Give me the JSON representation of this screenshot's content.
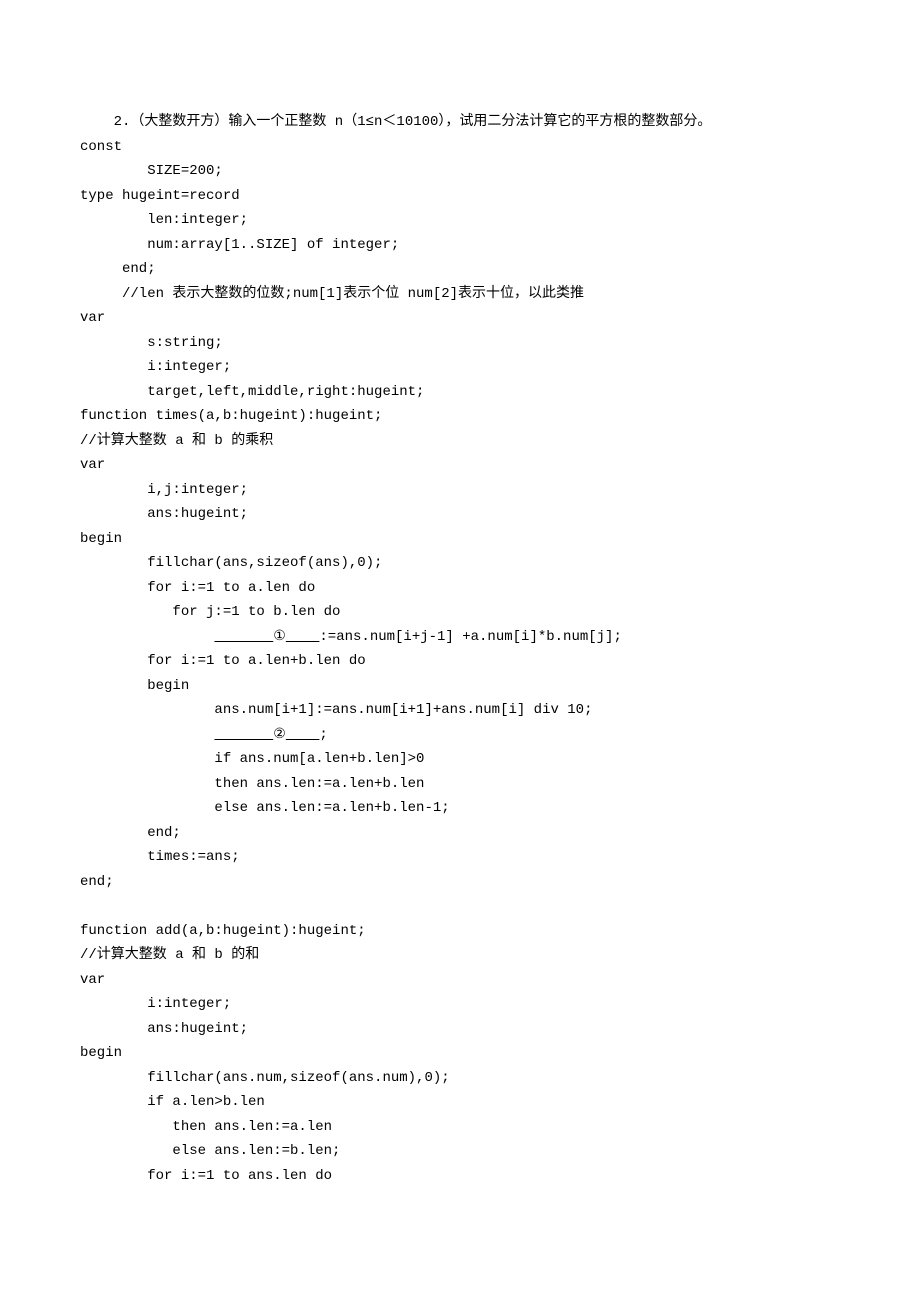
{
  "lines": [
    "    2.（大整数开方）输入一个正整数 n（1≤n＜10100），试用二分法计算它的平方根的整数部分。",
    "const",
    "        SIZE=200;",
    "type hugeint=record",
    "        len:integer;",
    "        num:array[1..SIZE] of integer;",
    "     end;",
    "     //len 表示大整数的位数;num[1]表示个位 num[2]表示十位，以此类推",
    "var",
    "        s:string;",
    "        i:integer;",
    "        target,left,middle,right:hugeint;",
    "function times(a,b:hugeint):hugeint;",
    "//计算大整数 a 和 b 的乘积",
    "var",
    "        i,j:integer;",
    "        ans:hugeint;",
    "begin",
    "        fillchar(ans,sizeof(ans),0);",
    "        for i:=1 to a.len do",
    "           for j:=1 to b.len do",
    "                       ①    :=ans.num[i+j-1] +a.num[i]*b.num[j];",
    "        for i:=1 to a.len+b.len do",
    "        begin",
    "                ans.num[i+1]:=ans.num[i+1]+ans.num[i] div 10;",
    "                       ②    ;",
    "                if ans.num[a.len+b.len]>0",
    "                then ans.len:=a.len+b.len",
    "                else ans.len:=a.len+b.len-1;",
    "        end;",
    "        times:=ans;",
    "end;",
    "",
    "function add(a,b:hugeint):hugeint;",
    "//计算大整数 a 和 b 的和",
    "var",
    "        i:integer;",
    "        ans:hugeint;",
    "begin",
    "        fillchar(ans.num,sizeof(ans.num),0);",
    "        if a.len>b.len",
    "           then ans.len:=a.len",
    "           else ans.len:=b.len;",
    "        for i:=1 to ans.len do"
  ],
  "blank_lines": {
    "21": {
      "prefix": "                ",
      "blank_before": "       ",
      "marker": "①",
      "blank_after": "    ",
      "suffix": ":=ans.num[i+j-1] +a.num[i]*b.num[j];"
    },
    "25": {
      "prefix": "                ",
      "blank_before": "       ",
      "marker": "②",
      "blank_after": "    ",
      "suffix": ";"
    }
  }
}
